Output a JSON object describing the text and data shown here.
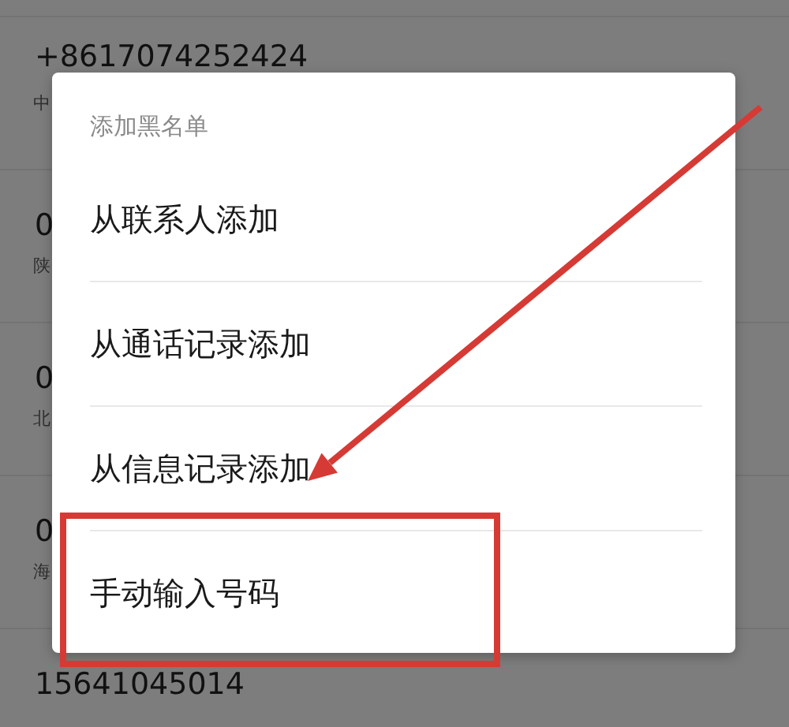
{
  "background_list": {
    "rows": [
      {
        "number": "+8617074252424",
        "location": "中"
      },
      {
        "number": "0",
        "location": "陕"
      },
      {
        "number": "0",
        "location": "北"
      },
      {
        "number": "0",
        "location": "海"
      },
      {
        "number": "15641045014"
      }
    ]
  },
  "dialog": {
    "title": "添加黑名单",
    "items": [
      {
        "label": "从联系人添加"
      },
      {
        "label": "从通话记录添加"
      },
      {
        "label": "从信息记录添加"
      },
      {
        "label": "手动输入号码"
      }
    ]
  }
}
